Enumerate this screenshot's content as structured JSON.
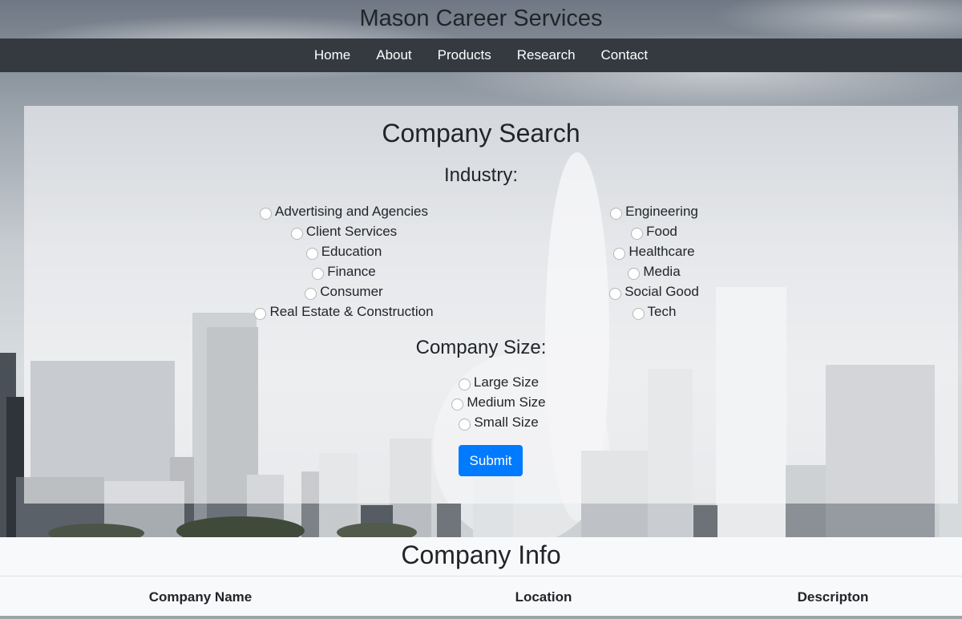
{
  "header": {
    "title": "Mason Career Services"
  },
  "nav": {
    "items": [
      "Home",
      "About",
      "Products",
      "Research",
      "Contact"
    ]
  },
  "search": {
    "title": "Company Search",
    "industry_label": "Industry:",
    "industries_left": [
      "Advertising and Agencies",
      "Client Services",
      "Education",
      "Finance",
      "Consumer",
      "Real Estate & Construction"
    ],
    "industries_right": [
      "Engineering",
      "Food",
      "Healthcare",
      "Media",
      "Social Good",
      "Tech"
    ],
    "size_label": "Company Size:",
    "sizes": [
      "Large Size",
      "Medium Size",
      "Small Size"
    ],
    "submit_label": "Submit"
  },
  "info": {
    "title": "Company Info",
    "columns": [
      "Company Name",
      "Location",
      "Descripton"
    ]
  },
  "colors": {
    "navbar": "#343a40",
    "primary": "#007bff"
  }
}
